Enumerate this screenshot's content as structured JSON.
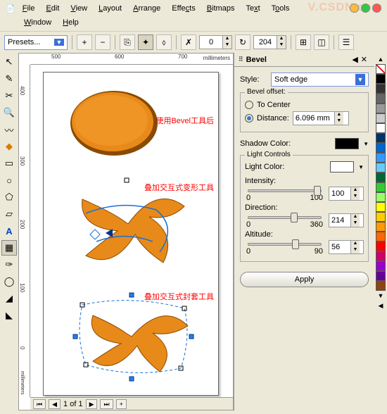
{
  "menu": {
    "items": [
      "File",
      "Edit",
      "View",
      "Layout",
      "Arrange",
      "Effects",
      "Bitmaps",
      "Text",
      "Tools",
      "Window",
      "Help"
    ]
  },
  "toolbar": {
    "preset_label": "Presets...",
    "rotation": "0",
    "nudge": "204",
    "ruler_unit": "millimeters",
    "ruler_h_ticks": [
      "500",
      "600",
      "700"
    ],
    "ruler_v_ticks": [
      "400",
      "300",
      "200",
      "100",
      "0"
    ]
  },
  "left_tools": [
    "pick",
    "shape",
    "crop",
    "zoom",
    "freehand",
    "smart",
    "rect",
    "ellipse",
    "polygon",
    "basic",
    "text",
    "interactive",
    "eyedrop",
    "outline",
    "fill",
    "ifill"
  ],
  "annotations": {
    "a1": "使用Bevel工具后",
    "a2": "叠加交互式变形工具",
    "a3": "叠加交互式封套工具"
  },
  "status": {
    "page_of": "1 of 1"
  },
  "bevel": {
    "title": "Bevel",
    "style_label": "Style:",
    "style_value": "Soft edge",
    "offset_legend": "Bevel offset:",
    "to_center": "To Center",
    "distance_label": "Distance:",
    "distance_value": "6.096 mm",
    "shadow_label": "Shadow Color:",
    "light_legend": "Light Controls",
    "light_color_label": "Light Color:",
    "intensity_label": "Intensity:",
    "intensity_value": "100",
    "intensity_min": "0",
    "intensity_max": "100",
    "direction_label": "Direction:",
    "direction_value": "214",
    "direction_min": "0",
    "direction_max": "360",
    "altitude_label": "Altitude:",
    "altitude_value": "56",
    "altitude_min": "0",
    "altitude_max": "90",
    "apply": "Apply"
  },
  "palette": [
    "#000000",
    "#333333",
    "#666666",
    "#999999",
    "#cccccc",
    "#ffffff",
    "#003366",
    "#0066cc",
    "#3399ff",
    "#66ccff",
    "#006633",
    "#33cc33",
    "#99ff66",
    "#ffff00",
    "#ffcc00",
    "#ff9900",
    "#ff6600",
    "#ff0000",
    "#cc0066",
    "#9900cc",
    "#660099",
    "#8b4513"
  ],
  "watermark": "V.CSDN.com"
}
